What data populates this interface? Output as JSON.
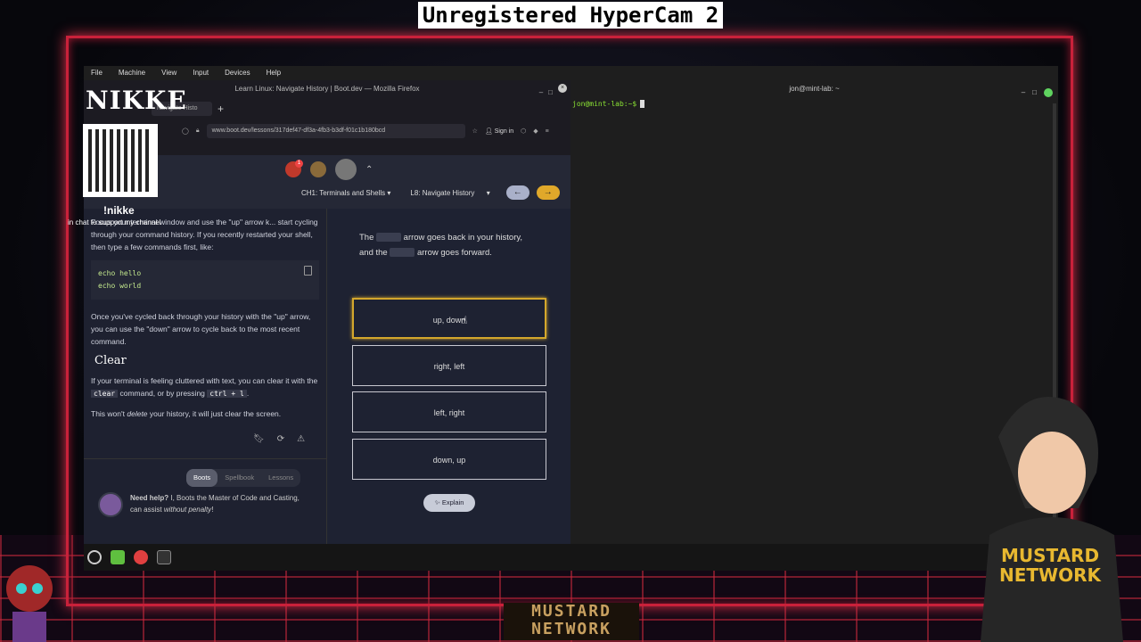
{
  "overlay": {
    "hypercam": "Unregistered HyperCam 2",
    "nikke_logo": "NIKKE",
    "nikke_command": "!nikke",
    "nikke_support": "in chat to support my channel",
    "mustard_logo_line1": "MUSTARD",
    "mustard_logo_line2": "NETWORK",
    "hoodie_text": "MUSTARD NETWORK"
  },
  "vm_menu": [
    "File",
    "Machine",
    "View",
    "Input",
    "Devices",
    "Help"
  ],
  "firefox": {
    "title": "Learn Linux: Navigate History | Boot.dev — Mozilla Firefox",
    "tab_label": "Navigate Histo",
    "url": "www.boot.dev/lessons/317def47-df3a-4fb3-b3df-f01c1b180bcd",
    "sign_in": "Sign in",
    "notification_count": "1"
  },
  "bootdev": {
    "chapter_select": "CH1: Terminals and Shells",
    "lesson_select": "L8: Navigate History",
    "lesson": {
      "para1": "Focus your terminal window and use the \"up\" arrow k... start cycling through your command history. If you recently restarted your shell, then type a few commands first, like:",
      "code_line1": "echo hello",
      "code_line2": "echo world",
      "para2": "Once you've cycled back through your history with the \"up\" arrow, you can use the \"down\" arrow to cycle back to the most recent command.",
      "heading": "Clear",
      "para3_a": "If your terminal is feeling cluttered with text, you can clear it with the",
      "para3_code1": "clear",
      "para3_b": "command, or by pressing",
      "para3_code2": "ctrl + l",
      "para3_c": ".",
      "para4_a": "This won't",
      "para4_em": "delete",
      "para4_b": "your history, it will just clear the screen."
    },
    "tabs": [
      "Boots",
      "Spellbook",
      "Lessons"
    ],
    "help_title": "Need help?",
    "help_text_a": "I, Boots the Master of Code and Casting, can assist",
    "help_text_em": "without penalty",
    "help_text_b": "!",
    "quiz": {
      "q_part1": "The",
      "q_part2": "arrow goes back in your history, and the",
      "q_part3": "arrow goes forward.",
      "answers": [
        "up, down",
        "right, left",
        "left, right",
        "down, up"
      ],
      "selected_index": 0,
      "explain": "Explain"
    }
  },
  "terminal": {
    "title": "jon@mint-lab: ~",
    "prompt": "jon@mint-lab:~$"
  },
  "colors": {
    "accent_gold": "#d4a72c",
    "frame_red": "#c9213a",
    "prompt_green": "#8ae234"
  }
}
